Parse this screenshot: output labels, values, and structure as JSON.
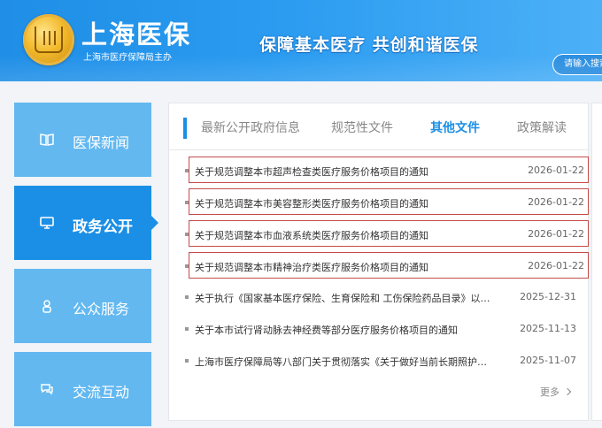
{
  "header": {
    "site_title": "上海医保",
    "site_subtitle": "上海市医疗保障局主办",
    "slogan": "保障基本医疗  共创和谐医保",
    "search_placeholder": "请输入搜索"
  },
  "sidebar": {
    "items": [
      {
        "label": "医保新闻",
        "icon": "book-icon",
        "active": false
      },
      {
        "label": "政务公开",
        "icon": "monitor-icon",
        "active": true
      },
      {
        "label": "公众服务",
        "icon": "person-icon",
        "active": false
      },
      {
        "label": "交流互动",
        "icon": "chat-icon",
        "active": false
      }
    ]
  },
  "tabs": [
    {
      "label": "最新公开政府信息",
      "active": false
    },
    {
      "label": "规范性文件",
      "active": false
    },
    {
      "label": "其他文件",
      "active": true
    },
    {
      "label": "政策解读",
      "active": false
    }
  ],
  "news": [
    {
      "title": "关于规范调整本市超声检查类医疗服务价格项目的通知",
      "date": "2026-01-22",
      "highlighted": true
    },
    {
      "title": "关于规范调整本市美容整形类医疗服务价格项目的通知",
      "date": "2026-01-22",
      "highlighted": true
    },
    {
      "title": "关于规范调整本市血液系统类医疗服务价格项目的通知",
      "date": "2026-01-22",
      "highlighted": true
    },
    {
      "title": "关于规范调整本市精神治疗类医疗服务价格项目的通知",
      "date": "2026-01-22",
      "highlighted": true
    },
    {
      "title": "关于执行《国家基本医疗保险、生育保险和 工伤保险药品目录》以及《商...",
      "date": "2025-12-31",
      "highlighted": false
    },
    {
      "title": "关于本市试行肾动脉去神经费等部分医疗服务价格项目的通知",
      "date": "2025-11-13",
      "highlighted": false
    },
    {
      "title": "上海市医疗保障局等八部门关于贯彻落实《关于做好当前长期照护师培养...",
      "date": "2025-11-07",
      "highlighted": false
    }
  ],
  "more_label": "更多",
  "colors": {
    "brand_blue": "#1b8fe6",
    "side_light": "#63b8f0",
    "highlight_border": "#c64b4b"
  }
}
